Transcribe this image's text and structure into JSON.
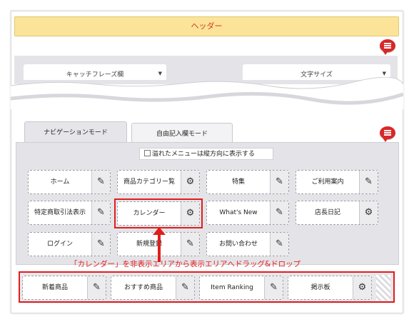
{
  "header": {
    "label": "ヘッダー"
  },
  "top_fields": {
    "catchphrase_label": "キャッチフレーズ欄",
    "font_size_label": "文字サイズ"
  },
  "tabs": [
    {
      "label": "ナビゲーションモード",
      "active": true
    },
    {
      "label": "自由記入欄モード",
      "active": false
    }
  ],
  "nav_options": {
    "overflow_vertical_label": "溢れたメニューは縦方向に表示する",
    "overflow_checked": false
  },
  "nav_items": [
    {
      "label": "ホーム",
      "icon": "pencil-icon"
    },
    {
      "label": "商品カテゴリー覧",
      "icon": "gear-icon"
    },
    {
      "label": "特集",
      "icon": "pencil-icon"
    },
    {
      "label": "ご利用案内",
      "icon": "pencil-icon"
    },
    {
      "label": "特定商取引法表示",
      "icon": "pencil-icon"
    },
    {
      "label": "カレンダー",
      "icon": "gear-icon"
    },
    {
      "label": "What's New",
      "icon": "pencil-icon"
    },
    {
      "label": "店長日記",
      "icon": "gear-icon"
    },
    {
      "label": "ログイン",
      "icon": "pencil-icon"
    },
    {
      "label": "新規登録",
      "icon": "pencil-icon"
    },
    {
      "label": "お問い合わせ",
      "icon": "pencil-icon"
    }
  ],
  "annotation": {
    "text": "「カレンダー」を非表示エリアから表示エリアへドラッグ&ドロップ"
  },
  "hidden_items": [
    {
      "label": "新着商品",
      "icon": "pencil-icon"
    },
    {
      "label": "おすすめ商品",
      "icon": "pencil-icon"
    },
    {
      "label": "Item Ranking",
      "icon": "pencil-icon"
    },
    {
      "label": "掲示板",
      "icon": "gear-icon"
    }
  ],
  "icons": {
    "pencil": "✎",
    "gear": "⚙"
  },
  "colors": {
    "header_bg": "#fbe49a",
    "header_text": "#d63a1c",
    "highlight": "#e11d1d",
    "panel_bg": "#e4e4e8"
  }
}
